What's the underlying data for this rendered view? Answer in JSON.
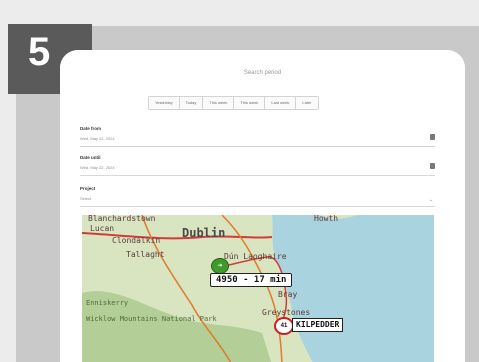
{
  "step": {
    "number": "5"
  },
  "screen": {
    "title": "Search period"
  },
  "presets": [
    "Yesterday",
    "Today",
    "This week",
    "This week",
    "Last week",
    "Later"
  ],
  "date_from": {
    "label": "Date from",
    "value": "Wed, May 22, 2024"
  },
  "date_until": {
    "label": "Date until",
    "value": "Wed, May 22, 2024"
  },
  "project": {
    "label": "Project",
    "placeholder": "Select"
  },
  "map": {
    "places": {
      "blanchardstown": "Blanchardstown",
      "lucan": "Lucan",
      "clondalkin": "Clondalkin",
      "tallaght": "Tallaght",
      "dublin": "Dublin",
      "dun_laoghaire": "Dún Laoghaire",
      "howth": "Howth",
      "bray": "Bray",
      "greystones": "Greystones",
      "wicklow_mountains": "Wicklow Mountains National Park",
      "enniskerry": "Enniskerry"
    },
    "route_label": "4950 - 17 min",
    "destination_label": "KILPEDDER",
    "green_pin": "➔",
    "red_pin": "41",
    "colors": {
      "sea": "#a9d3de",
      "land": "#d9e4c1",
      "forest": "#a9c98c",
      "road": "#e07a2c",
      "motorway": "#d13b3b"
    }
  }
}
